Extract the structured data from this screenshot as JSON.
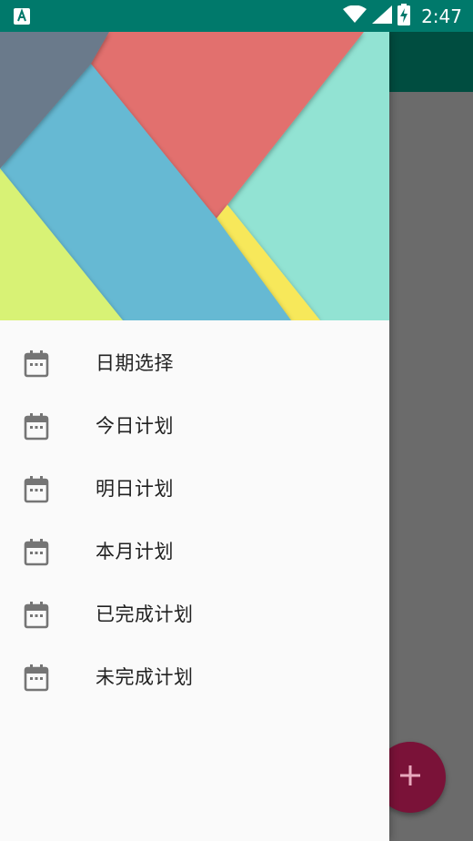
{
  "status_bar": {
    "time": "2:47",
    "icons": [
      "app-notification-icon",
      "wifi-icon",
      "signal-icon",
      "battery-charging-icon"
    ]
  },
  "colors": {
    "status_bar": "#00796b",
    "toolbar": "#004d40",
    "drawer": "#fafafa",
    "fab": "#7a1238",
    "header_slate": "#6b7a8b",
    "header_red": "#e2706e",
    "header_blue": "#66b9d3",
    "header_teal": "#92e3d3",
    "header_lime": "#d8f274",
    "header_yellow": "#f7e85a"
  },
  "drawer": {
    "menu": [
      {
        "label": "日期选择",
        "icon": "calendar-icon"
      },
      {
        "label": "今日计划",
        "icon": "calendar-icon"
      },
      {
        "label": "明日计划",
        "icon": "calendar-icon"
      },
      {
        "label": "本月计划",
        "icon": "calendar-icon"
      },
      {
        "label": "已完成计划",
        "icon": "calendar-icon"
      },
      {
        "label": "未完成计划",
        "icon": "calendar-icon"
      }
    ]
  },
  "fab": {
    "icon": "plus-icon"
  }
}
